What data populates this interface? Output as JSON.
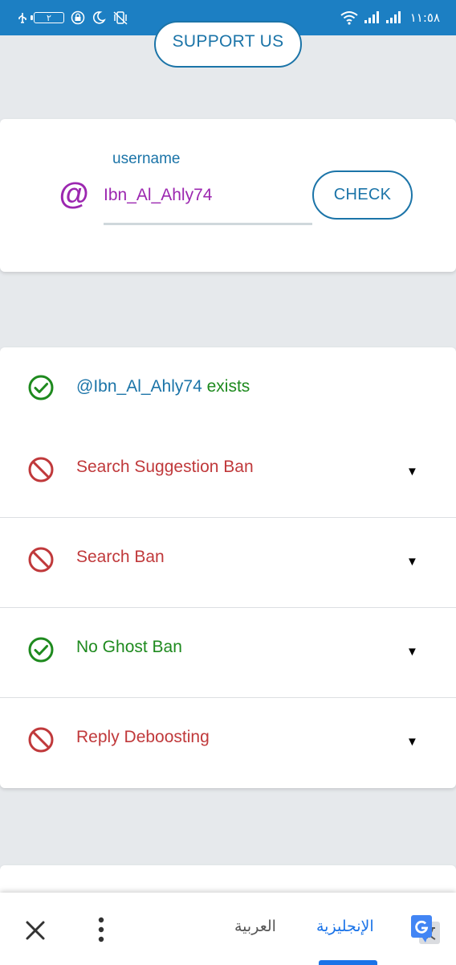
{
  "status_bar": {
    "battery_level": "٢",
    "time": "١١:٥٨",
    "color": "#1c7fc3"
  },
  "support_button": {
    "label": "SUPPORT US"
  },
  "check_form": {
    "field_label": "username",
    "at_symbol": "@",
    "username_value": "Ibn_Al_Ahly74",
    "check_label": "CHECK"
  },
  "results": {
    "items": [
      {
        "text": "@Ibn_Al_Ahly74 exists",
        "status": "ok",
        "icon": "check-circle-icon",
        "expandable": false
      },
      {
        "text": "Search Suggestion Ban",
        "status": "banned",
        "icon": "ban-icon",
        "expandable": true
      },
      {
        "text": "Search Ban",
        "status": "banned",
        "icon": "ban-icon",
        "expandable": true
      },
      {
        "text": "No Ghost Ban",
        "status": "ok",
        "icon": "check-circle-icon",
        "expandable": true
      },
      {
        "text": "Reply Deboosting",
        "status": "banned",
        "icon": "ban-icon",
        "expandable": true
      }
    ],
    "expand_arrow": "▼"
  },
  "translate_bar": {
    "source_language": "العربية",
    "target_language": "الإنجليزية",
    "active_color": "#1a73e8"
  },
  "colors": {
    "accent_blue": "#1b74a8",
    "purple": "#9c27b0",
    "ok_green": "#1e8a1e",
    "ban_red": "#c0393b"
  }
}
